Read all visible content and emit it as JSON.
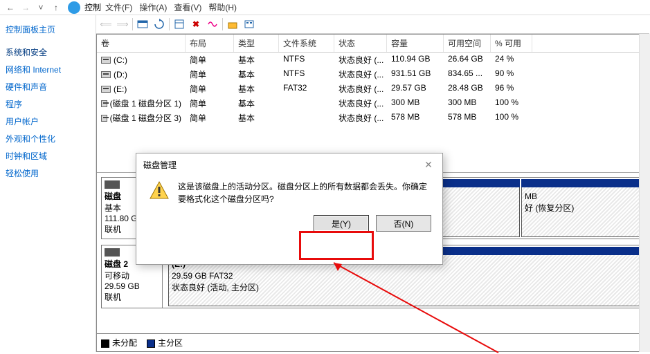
{
  "topbar": {
    "location": "控制"
  },
  "menus": [
    "文件(F)",
    "操作(A)",
    "查看(V)",
    "帮助(H)"
  ],
  "sidebar": {
    "items": [
      "控制面板主页",
      "系统和安全",
      "网络和 Internet",
      "硬件和声音",
      "程序",
      "用户帐户",
      "外观和个性化",
      "时钟和区域",
      "轻松使用"
    ]
  },
  "grid": {
    "headers": [
      "卷",
      "布局",
      "类型",
      "文件系统",
      "状态",
      "容量",
      "可用空间",
      "% 可用"
    ],
    "rows": [
      {
        "name": "(C:)",
        "layout": "简单",
        "type": "基本",
        "fs": "NTFS",
        "status": "状态良好 (...",
        "size": "110.94 GB",
        "free": "26.64 GB",
        "pct": "24 %"
      },
      {
        "name": "(D:)",
        "layout": "简单",
        "type": "基本",
        "fs": "NTFS",
        "status": "状态良好 (...",
        "size": "931.51 GB",
        "free": "834.65 ...",
        "pct": "90 %"
      },
      {
        "name": "(E:)",
        "layout": "简单",
        "type": "基本",
        "fs": "FAT32",
        "status": "状态良好 (...",
        "size": "29.57 GB",
        "free": "28.48 GB",
        "pct": "96 %"
      },
      {
        "name": "(磁盘 1 磁盘分区 1)",
        "layout": "简单",
        "type": "基本",
        "fs": "",
        "status": "状态良好 (...",
        "size": "300 MB",
        "free": "300 MB",
        "pct": "100 %"
      },
      {
        "name": "(磁盘 1 磁盘分区 3)",
        "layout": "简单",
        "type": "基本",
        "fs": "",
        "status": "状态良好 (...",
        "size": "578 MB",
        "free": "578 MB",
        "pct": "100 %"
      }
    ]
  },
  "disks": {
    "disk0_label": "磁盘",
    "disk0_type": "基本",
    "disk0_size": "111.80 G",
    "disk0_status": "联机",
    "disk0_v1_cap": "MB",
    "disk0_v1_status": "好 (恢复分区)",
    "disk2_label": "磁盘 2",
    "disk2_type": "可移动",
    "disk2_size": "29.59 GB",
    "disk2_status": "联机",
    "disk2_v_name": "(E:)",
    "disk2_v_cap": "29.59 GB FAT32",
    "disk2_v_status": "状态良好 (活动, 主分区)"
  },
  "legend": {
    "unalloc": "未分配",
    "primary": "主分区"
  },
  "dialog": {
    "title": "磁盘管理",
    "message": "这是该磁盘上的活动分区。磁盘分区上的所有数据都会丢失。你确定要格式化这个磁盘分区吗?",
    "yes": "是(Y)",
    "no": "否(N)"
  }
}
